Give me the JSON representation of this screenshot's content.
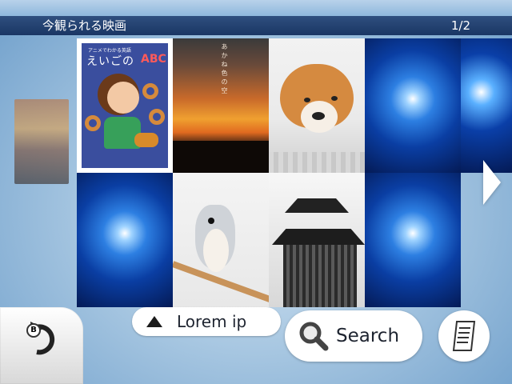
{
  "header": {
    "title": "今観られる映画",
    "page_indicator": "1/2"
  },
  "grid": {
    "items": [
      {
        "name": "book-cover",
        "label_small": "アニメでわかる英語",
        "label_big": "えいごの",
        "label_abc": "ABC"
      },
      {
        "name": "sunset",
        "vertical_text": "あかね色の空"
      },
      {
        "name": "shiba-puppy"
      },
      {
        "name": "blue-space"
      },
      {
        "name": "blue-space"
      },
      {
        "name": "titmouse-bird"
      },
      {
        "name": "temple"
      },
      {
        "name": "blue-space"
      }
    ]
  },
  "controls": {
    "back_badge": "B",
    "sort_label": "Lorem ip",
    "search_label": "Search"
  },
  "icons": {
    "back": "back-arrow-icon",
    "sort": "triangle-up-icon",
    "search": "magnifier-icon",
    "notes": "document-icon",
    "next": "chevron-right-icon"
  },
  "colors": {
    "header_bg": "#1a3664",
    "button_bg": "#ffffff",
    "text": "#1e2430"
  }
}
